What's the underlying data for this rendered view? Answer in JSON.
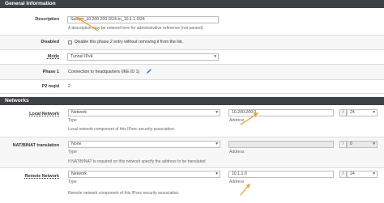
{
  "general": {
    "heading": "General Information",
    "description": {
      "label": "Description",
      "value": "Subnet_10.200.200.0/24-to_10.1.1.0/24",
      "help": "A description may be entered here for administrative reference (not parsed)."
    },
    "disabled": {
      "label": "Disabled",
      "checkbox_text": "Disable this phase 2 entry without removing it from the list.",
      "checked": false
    },
    "mode": {
      "label": "Mode",
      "value": "Tunnel IPv4"
    },
    "phase1": {
      "label": "Phase 1",
      "value": "Connection to headquarters (IKE ID 1)"
    },
    "p2reqid": {
      "label": "P2 reqid",
      "value": "2"
    }
  },
  "networks": {
    "heading": "Networks",
    "local": {
      "label": "Local Network",
      "type_value": "Network",
      "type_caption": "Type",
      "address_value": "10.200.200.0",
      "address_caption": "Address",
      "slash": "/",
      "mask": "24",
      "help": "Local network component of this IPsec security association."
    },
    "nat": {
      "label": "NAT/BINAT translation",
      "type_value": "None",
      "type_caption": "Type",
      "address_value": "",
      "address_caption": "Address",
      "slash": "/",
      "mask": "0",
      "help": "If NAT/BINAT is required on this network specify the address to be translated"
    },
    "remote": {
      "label": "Remote Network",
      "type_value": "Network",
      "type_caption": "Type",
      "address_value": "10.1.1.0",
      "address_caption": "Address",
      "slash": "/",
      "mask": "24",
      "help": "Remote network component of this IPsec security association."
    }
  },
  "colors": {
    "heading_bg": "#3f4246",
    "annotation_arrow": "#f0a030",
    "edit_icon": "#3a7bd5"
  },
  "icons": {
    "edit": "pencil-icon",
    "dropdown": "chevron-down-icon"
  }
}
